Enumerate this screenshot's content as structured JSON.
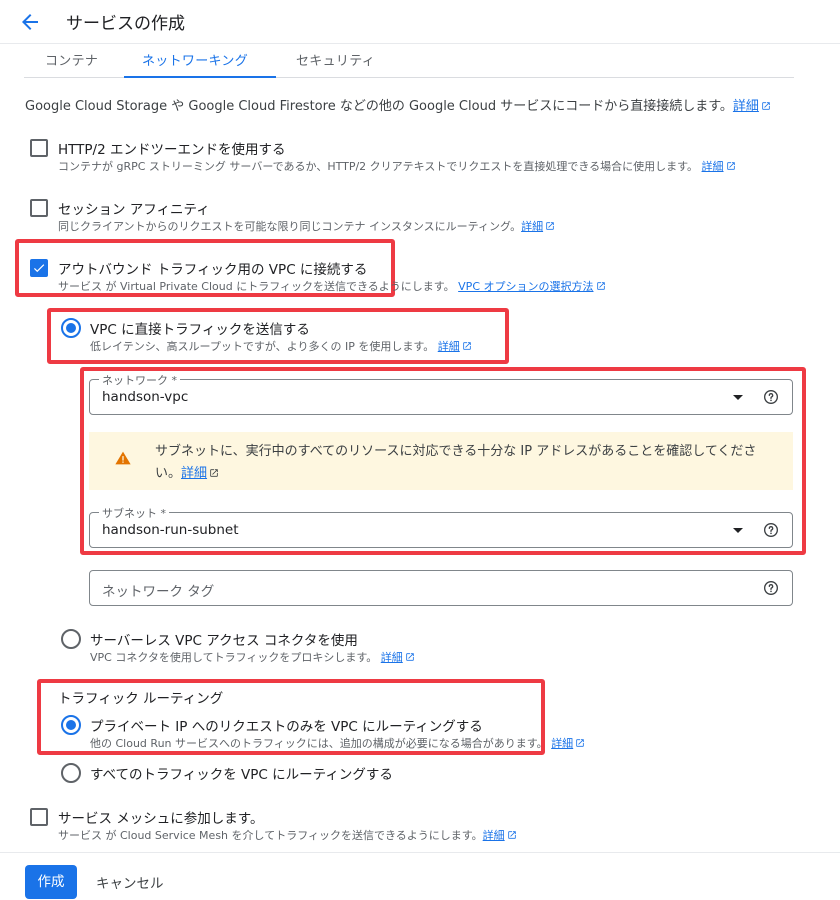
{
  "header": {
    "title": "サービスの作成"
  },
  "tabs": [
    {
      "label": "コンテナ"
    },
    {
      "label": "ネットワーキング"
    },
    {
      "label": "セキュリティ"
    }
  ],
  "intro": {
    "text": "Google Cloud Storage や Google Cloud Firestore などの他の Google Cloud サービスにコードから直接接続します。",
    "link": "詳細"
  },
  "http2": {
    "label": "HTTP/2 エンドツーエンドを使用する",
    "desc": "コンテナが gRPC ストリーミング サーバーであるか、HTTP/2 クリアテキストでリクエストを直接処理できる場合に使用します。",
    "link": "詳細",
    "checked": false
  },
  "session": {
    "label": "セッション アフィニティ",
    "desc": "同じクライアントからのリクエストを可能な限り同じコンテナ インスタンスにルーティング。",
    "link": "詳細",
    "checked": false
  },
  "vpc": {
    "label": "アウトバウンド トラフィック用の VPC に接続する",
    "desc": "サービス が Virtual Private Cloud にトラフィックを送信できるようにします。",
    "link": "VPC オプションの選択方法",
    "checked": true
  },
  "direct": {
    "label": "VPC に直接トラフィックを送信する",
    "desc": "低レイテンシ、高スループットですが、より多くの IP を使用します。",
    "link": "詳細",
    "selected": true
  },
  "network": {
    "label": "ネットワーク *",
    "value": "handson-vpc"
  },
  "warning": {
    "text": "サブネットに、実行中のすべてのリソースに対応できる十分な IP アドレスがあることを確認してください。",
    "link": "詳細"
  },
  "subnet": {
    "label": "サブネット *",
    "value": "handson-run-subnet"
  },
  "network_tag": {
    "placeholder": "ネットワーク タグ"
  },
  "connector": {
    "label": "サーバーレス VPC アクセス コネクタを使用",
    "desc": "VPC コネクタを使用してトラフィックをプロキシします。",
    "link": "詳細",
    "selected": false
  },
  "routing": {
    "title": "トラフィック ルーティング",
    "private": {
      "label": "プライベート IP へのリクエストのみを VPC にルーティングする",
      "desc": "他の Cloud Run サービスへのトラフィックには、追加の構成が必要になる場合があります。",
      "link": "詳細",
      "selected": true
    },
    "all": {
      "label": "すべてのトラフィックを VPC にルーティングする",
      "selected": false
    }
  },
  "mesh": {
    "label": "サービス メッシュに参加します。",
    "desc": "サービス が Cloud Service Mesh を介してトラフィックを送信できるようにします。",
    "link": "詳細",
    "checked": false
  },
  "footer": {
    "create": "作成",
    "cancel": "キャンセル"
  },
  "colors": {
    "accent": "#1a73e8",
    "highlight": "#ee3a43",
    "warning_bg": "#fef7e0",
    "warning_icon": "#e37400"
  }
}
